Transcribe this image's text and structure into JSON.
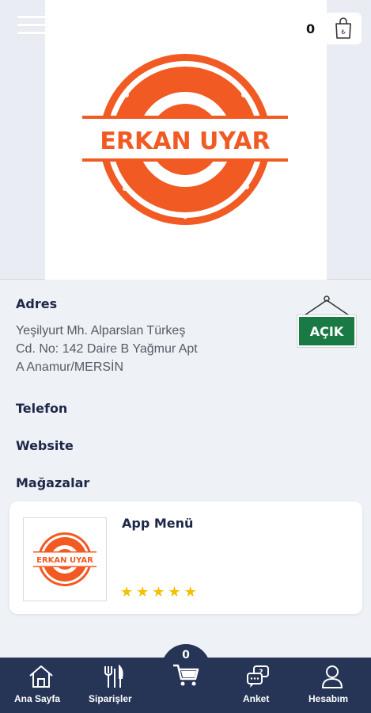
{
  "header": {
    "cart_count": "0",
    "logo_text": "ERKAN UYAR"
  },
  "info": {
    "address_label": "Adres",
    "address_lines": [
      "Yeşilyurt Mh. Alparslan Türkeş",
      "Cd. No: 142 Daire B Yağmur Apt",
      "A Anamur/MERSİN"
    ],
    "phone_label": "Telefon",
    "website_label": "Website",
    "stores_label": "Mağazalar",
    "status_sign": "AÇIK"
  },
  "store": {
    "title": "App Menü",
    "logo_text": "ERKAN UYAR",
    "rating": 5
  },
  "nav": {
    "home": "Ana Sayfa",
    "orders": "Siparişler",
    "cart_count": "0",
    "survey": "Anket",
    "account": "Hesabım"
  },
  "colors": {
    "brand_orange": "#f15a22",
    "nav_bg": "#263456",
    "open_green": "#1a7a45",
    "star_yellow": "#f2c200"
  },
  "icons": [
    "menu-icon",
    "shopping-bag-icon",
    "home-icon",
    "fork-knife-icon",
    "cart-icon",
    "chat-icon",
    "user-icon",
    "star-icon"
  ]
}
